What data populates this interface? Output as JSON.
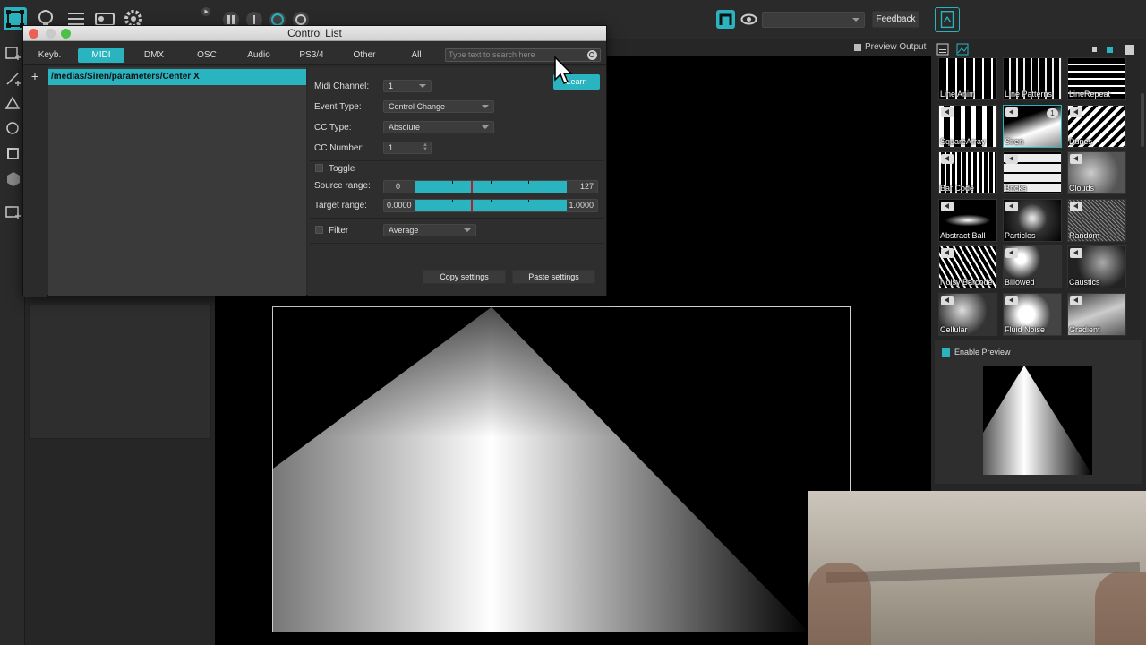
{
  "toolbar": {
    "preview_select_value": "",
    "feedback_label": "Feedback"
  },
  "preview_header": {
    "label": "Preview Output"
  },
  "dialog": {
    "title": "Control List",
    "tabs": [
      "Keyb.",
      "MIDI",
      "DMX",
      "OSC",
      "Audio",
      "PS3/4",
      "Other",
      "All"
    ],
    "active_tab": "MIDI",
    "search_placeholder": "Type text to search here",
    "list_items": [
      "/medias/Siren/parameters/Center X"
    ],
    "learn_label": "Learn",
    "midi_channel_label": "Midi Channel:",
    "midi_channel_value": "1",
    "event_type_label": "Event Type:",
    "event_type_value": "Control Change",
    "cc_type_label": "CC Type:",
    "cc_type_value": "Absolute",
    "cc_number_label": "CC Number:",
    "cc_number_value": "1",
    "toggle_label": "Toggle",
    "source_range_label": "Source range:",
    "source_range_min": "0",
    "source_range_max": "127",
    "target_range_label": "Target range:",
    "target_range_min": "0.0000",
    "target_range_max": "1.0000",
    "filter_label": "Filter",
    "filter_value": "Average",
    "copy_label": "Copy settings",
    "paste_label": "Paste settings"
  },
  "library": {
    "items": [
      "Line Anim",
      "Line Patterns",
      "LineRepeat",
      "SquareArray",
      "Siren",
      "Dunes",
      "Bar Code",
      "Bricks",
      "Clouds",
      "Abstract Ball",
      "Particles",
      "Random",
      "Noisy Barcode",
      "Billowed",
      "Caustics",
      "Cellular",
      "Fluid Noise",
      "Gradient"
    ],
    "selected": "Siren",
    "siren_badge": "1"
  },
  "preview": {
    "enable_label": "Enable Preview"
  },
  "colors": {
    "accent": "#2ab4c0",
    "panel": "#262626",
    "dialog": "#2b2b2b"
  }
}
